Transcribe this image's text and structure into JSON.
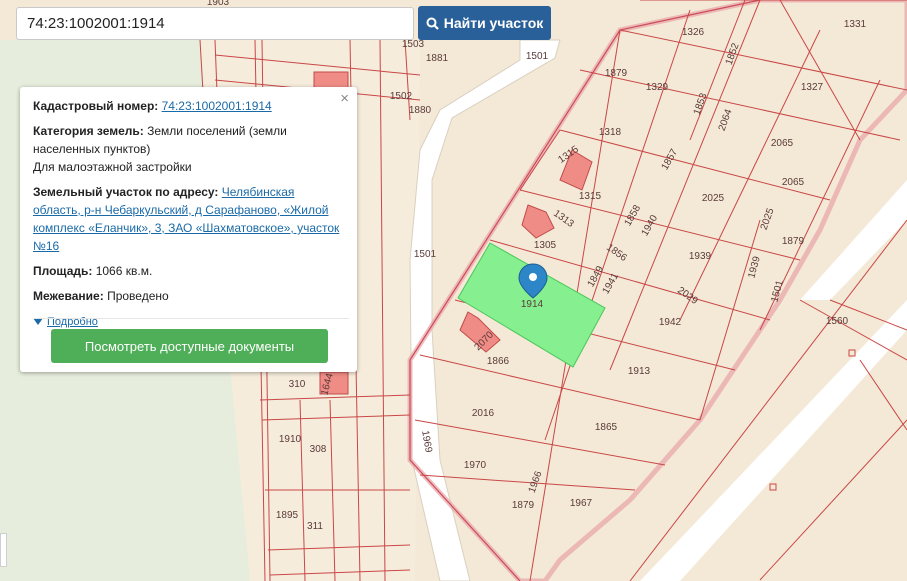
{
  "search": {
    "value": "74:23:1002001:1914",
    "button_label": "Найти участок"
  },
  "panel": {
    "cadastral_label": "Кадастровый номер:",
    "cadastral_value": "74:23:1002001:1914",
    "category_label": "Категория земель:",
    "category_value": "Земли поселений (земли населенных пунктов)",
    "category_use": "Для малоэтажной застройки",
    "address_label": "Земельный участок по адресу:",
    "address_value": "Челябинская область, р-н Чебаркульский, д Сарафаново, «Жилой комплекс «Еланчик», 3, ЗАО «Шахматовское», участок №16",
    "area_label": "Площадь:",
    "area_value": "1066 кв.м.",
    "survey_label": "Межевание:",
    "survey_value": "Проведено",
    "details_link": "Подробно",
    "close_symbol": "×",
    "docs_button": "Посмотреть доступные документы"
  },
  "map": {
    "plot_numbers": [
      "1903",
      "1503",
      "1881",
      "1502",
      "1880",
      "1501",
      "1326",
      "1852",
      "1331",
      "1879",
      "1329",
      "1327",
      "1318",
      "1853",
      "2064",
      "1315",
      "1315",
      "1857",
      "2065",
      "2065",
      "1313",
      "1305",
      "1858",
      "1940",
      "2025",
      "2025",
      "1879",
      "1856",
      "1501",
      "1939",
      "1939",
      "1849",
      "1941",
      "2029",
      "1914",
      "1942",
      "1501",
      "1560",
      "2070",
      "1866",
      "1913",
      "310",
      "1644",
      "2016",
      "1910",
      "308",
      "1865",
      "1969",
      "1970",
      "1966",
      "1879",
      "1967",
      "1895",
      "311"
    ],
    "selected_plot": "1914",
    "colors": {
      "background": "#f4e9d6",
      "plot_line": "#d04040",
      "selected_fill": "#86ef8f",
      "building": "#f08c86",
      "road": "#ffffff",
      "boundary": "#e08f95"
    }
  }
}
